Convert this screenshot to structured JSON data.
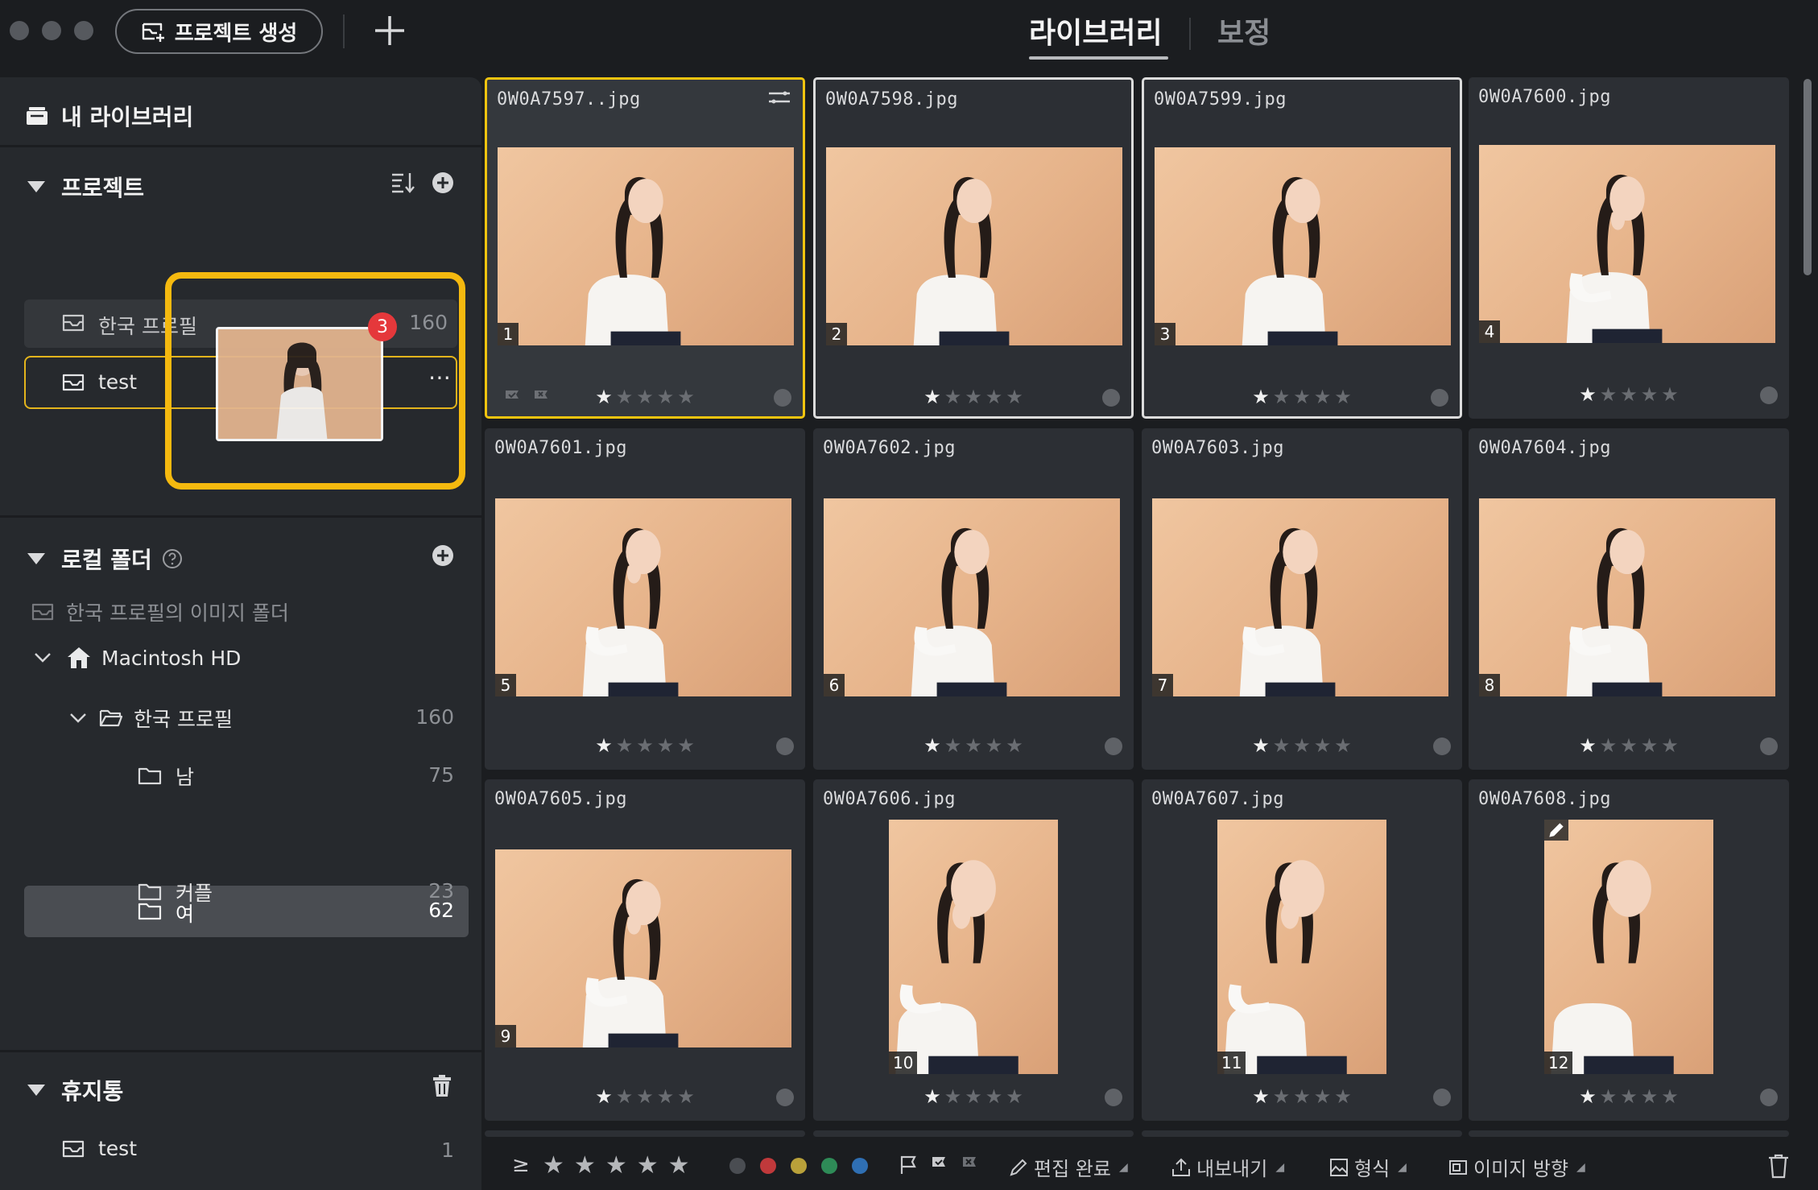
{
  "topbar": {
    "create_project_label": "프로젝트 생성",
    "tabs": {
      "library": "라이브러리",
      "edit": "보정"
    }
  },
  "sidebar": {
    "my_library": "내 라이브러리",
    "projects_section": "프로젝트",
    "projects": [
      {
        "name": "한국 프로필",
        "count": "160"
      },
      {
        "name": "test",
        "count": ""
      }
    ],
    "project_more": "⋯",
    "drag_badge": "3",
    "local_folders_section": "로컬 폴더",
    "project_image_folder": "한국 프로필의 이미지 폴더",
    "volume": "Macintosh HD",
    "folders": [
      {
        "name": "한국 프로필",
        "count": "160"
      },
      {
        "name": "남",
        "count": "75"
      },
      {
        "name": "여",
        "count": "62"
      },
      {
        "name": "커플",
        "count": "23"
      }
    ],
    "trash_section": "휴지통",
    "trash_items": [
      {
        "name": "test",
        "count": "1"
      }
    ]
  },
  "grid": {
    "photos": [
      {
        "name": "0W0A7597..jpg",
        "num": "1",
        "rating": 1,
        "orientation": "landscape",
        "pose": "open"
      },
      {
        "name": "0W0A7598.jpg",
        "num": "2",
        "rating": 1,
        "orientation": "landscape",
        "pose": "open"
      },
      {
        "name": "0W0A7599.jpg",
        "num": "3",
        "rating": 1,
        "orientation": "landscape",
        "pose": "open"
      },
      {
        "name": "0W0A7600.jpg",
        "num": "4",
        "rating": 1,
        "orientation": "landscape",
        "pose": "hand"
      },
      {
        "name": "0W0A7601.jpg",
        "num": "5",
        "rating": 1,
        "orientation": "landscape",
        "pose": "hand"
      },
      {
        "name": "0W0A7602.jpg",
        "num": "6",
        "rating": 1,
        "orientation": "landscape",
        "pose": "crossed"
      },
      {
        "name": "0W0A7603.jpg",
        "num": "7",
        "rating": 1,
        "orientation": "landscape",
        "pose": "crossed"
      },
      {
        "name": "0W0A7604.jpg",
        "num": "8",
        "rating": 1,
        "orientation": "landscape",
        "pose": "crossed"
      },
      {
        "name": "0W0A7605.jpg",
        "num": "9",
        "rating": 1,
        "orientation": "landscape",
        "pose": "hand"
      },
      {
        "name": "0W0A7606.jpg",
        "num": "10",
        "rating": 1,
        "orientation": "portrait",
        "pose": "hand"
      },
      {
        "name": "0W0A7607.jpg",
        "num": "11",
        "rating": 1,
        "orientation": "portrait",
        "pose": "hand"
      },
      {
        "name": "0W0A7608.jpg",
        "num": "12",
        "rating": 1,
        "orientation": "portrait",
        "pose": "closeup"
      }
    ]
  },
  "bottombar": {
    "rating_op": "≥",
    "colors": [
      "#4a4d52",
      "#c0393b",
      "#b9a13a",
      "#2e8b57",
      "#2f6fb3"
    ],
    "edit_done": "편집 완료",
    "export": "내보내기",
    "format": "형식",
    "orientation": "이미지 방향"
  }
}
